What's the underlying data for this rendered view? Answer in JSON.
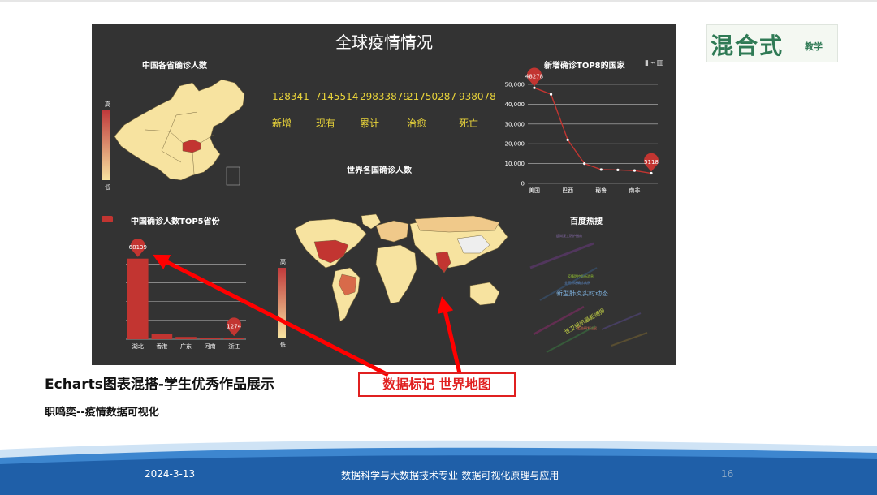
{
  "dashboard": {
    "title": "全球疫情情况",
    "toolbox_icons": [
      "save-icon",
      "line-icon",
      "bar-icon"
    ]
  },
  "china_map": {
    "title": "中国各省确诊人数",
    "legend_high": "高",
    "legend_low": "低"
  },
  "world_map": {
    "title": "世界各国确诊人数",
    "legend_high": "高",
    "legend_low": "低"
  },
  "stats": {
    "values": [
      "128341",
      "7145514",
      "29833879",
      "21750287",
      "938078"
    ],
    "labels": [
      "新增",
      "现有",
      "累计",
      "治愈",
      "死亡"
    ]
  },
  "hot_search": {
    "title": "百度热搜",
    "words": [
      "新型肺炎实时动态",
      "疫情防控最新消息",
      "全国新增确诊病例",
      "世卫组织最新通报",
      "疫苗研发进展",
      "返岗复工防护指南"
    ]
  },
  "chart_data": [
    {
      "type": "line",
      "title": "新增确诊TOP8的国家",
      "categories": [
        "美国",
        "",
        "巴西",
        "",
        "秘鲁",
        "",
        "南非",
        ""
      ],
      "values": [
        48278,
        45000,
        22000,
        10000,
        7000,
        6800,
        6500,
        5118
      ],
      "ylim": [
        0,
        50000
      ],
      "yticks": [
        "0",
        "10,000",
        "20,000",
        "30,000",
        "40,000",
        "50,000"
      ],
      "markers": [
        {
          "index": 0,
          "label": "48278"
        },
        {
          "index": 7,
          "label": "5118"
        }
      ],
      "color": "#c23531"
    },
    {
      "type": "bar",
      "title": "中国确诊人数TOP5省份",
      "categories": [
        "湖北",
        "香港",
        "广东",
        "河南",
        "浙江"
      ],
      "values": [
        68139,
        4800,
        1900,
        1280,
        1274
      ],
      "markers": [
        {
          "index": 0,
          "label": "68139"
        },
        {
          "index": 4,
          "label": "1274"
        }
      ],
      "color": "#c23531"
    }
  ],
  "captions": {
    "main": "Echarts图表混搭-学生优秀作品展示",
    "callout": "数据标记   世界地图",
    "sub": "职鸣奕--疫情数据可视化"
  },
  "logo": {
    "main": "混合式",
    "sub": "教学"
  },
  "footer": {
    "date": "2024-3-13",
    "course": "数据科学与大数据技术专业-数据可视化原理与应用",
    "page": "16"
  },
  "colors": {
    "dashboard_bg": "#333333",
    "accent_red": "#c23531",
    "stat_yellow": "#e8d33a",
    "map_light": "#f7e3a0",
    "callout_red": "#e02020",
    "footer_blue": "#1f5fa8"
  }
}
